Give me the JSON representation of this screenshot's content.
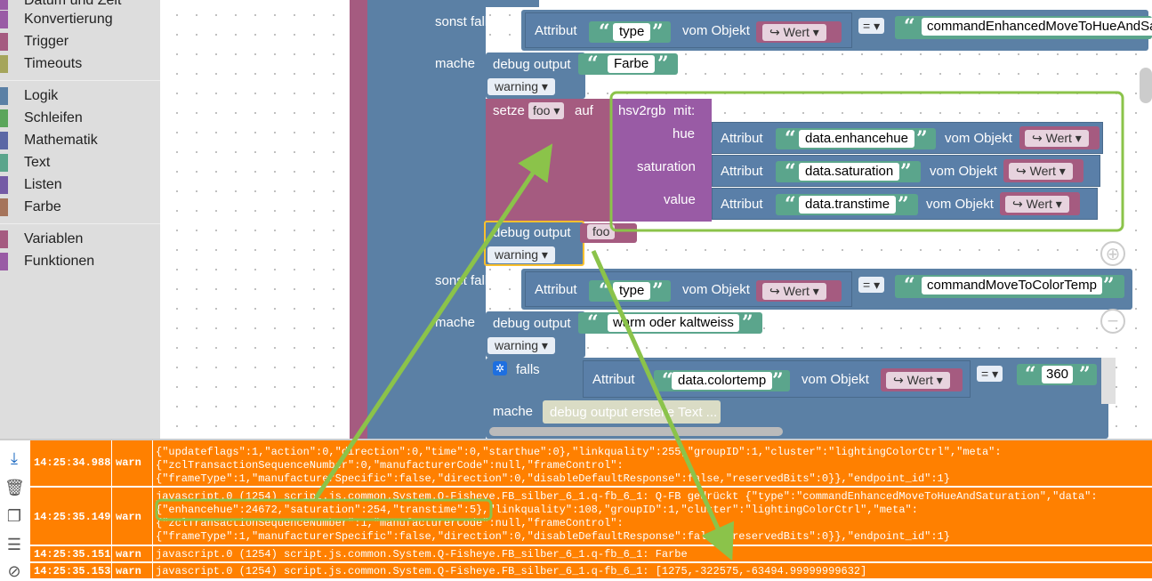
{
  "toolbox": {
    "items": [
      {
        "label": "Datum und Zeit",
        "color": "#995ba5"
      },
      {
        "label": "Konvertierung",
        "color": "#995ba5"
      },
      {
        "label": "Trigger",
        "color": "#a55b80"
      },
      {
        "label": "Timeouts",
        "color": "#a5a55b"
      },
      {
        "label": "Logik",
        "color": "#5b80a5"
      },
      {
        "label": "Schleifen",
        "color": "#5ba55b"
      },
      {
        "label": "Mathematik",
        "color": "#5b67a5"
      },
      {
        "label": "Text",
        "color": "#5ba58c"
      },
      {
        "label": "Listen",
        "color": "#745ba5"
      },
      {
        "label": "Farbe",
        "color": "#a5745b"
      },
      {
        "label": "Variablen",
        "color": "#a55b80"
      },
      {
        "label": "Funktionen",
        "color": "#995ba5"
      }
    ]
  },
  "blocks": {
    "sonst_falls": "sonst falls",
    "mache": "mache",
    "attribut": "Attribut",
    "vom_objekt": "vom Objekt",
    "wert": "↪ Wert",
    "eq": "=",
    "debug_output": "debug output",
    "warning": "warning",
    "setze": "setze",
    "auf": "auf",
    "foo": "foo",
    "hsv2rgb": "hsv2rgb",
    "mit": "mit:",
    "hue": "hue",
    "saturation": "saturation",
    "value": "value",
    "falls": "falls",
    "type": "type",
    "farbe": "Farbe",
    "cmd1": "commandEnhancedMoveToHueAndSa",
    "cmd2": "commandMoveToColorTemp",
    "data_enhancehue": "data.enhancehue",
    "data_saturation": "data.saturation",
    "data_transtime": "data.transtime",
    "warm_kalt": "warm oder kaltweiss",
    "data_colortemp": "data.colortemp",
    "n360": "360",
    "debug_erstelle": "debug output erstelle Text ..."
  },
  "log": {
    "rows": [
      {
        "time": "14:25:34.988",
        "level": "warn",
        "message": "{\"updateflags\":1,\"action\":0,\"direction\":0,\"time\":0,\"starthue\":0},\"linkquality\":255,\"groupID\":1,\"cluster\":\"lightingColorCtrl\",\"meta\":\n{\"zclTransactionSequenceNumber\":0,\"manufacturerCode\":null,\"frameControl\":\n{\"frameType\":1,\"manufacturerSpecific\":false,\"direction\":0,\"disableDefaultResponse\":false,\"reservedBits\":0}},\"endpoint_id\":1}"
      },
      {
        "time": "14:25:35.149",
        "level": "warn",
        "message": "javascript.0 (1254) script.js.common.System.Q-Fisheye.FB_silber_6_1.q-fb_6_1: Q-FB gedrückt {\"type\":\"commandEnhancedMoveToHueAndSaturation\",\"data\":\n{\"enhancehue\":24672,\"saturation\":254,\"transtime\":5},\"linkquality\":108,\"groupID\":1,\"cluster\":\"lightingColorCtrl\",\"meta\":\n{\"zclTransactionSequenceNumber\":1,\"manufacturerCode\":null,\"frameControl\":\n{\"frameType\":1,\"manufacturerSpecific\":false,\"direction\":0,\"disableDefaultResponse\":false,\"reservedBits\":0}},\"endpoint_id\":1}"
      },
      {
        "time": "14:25:35.151",
        "level": "warn",
        "message": "javascript.0 (1254) script.js.common.System.Q-Fisheye.FB_silber_6_1.q-fb_6_1: Farbe"
      },
      {
        "time": "14:25:35.153",
        "level": "warn",
        "message": "javascript.0 (1254) script.js.common.System.Q-Fisheye.FB_silber_6_1.q-fb_6_1: [1275,-322575,-63494.99999999632]"
      }
    ]
  },
  "colors": {
    "log_warn_bg": "#ff8000",
    "annotation": "#8bc34a",
    "highlight": "#fbc02d"
  }
}
